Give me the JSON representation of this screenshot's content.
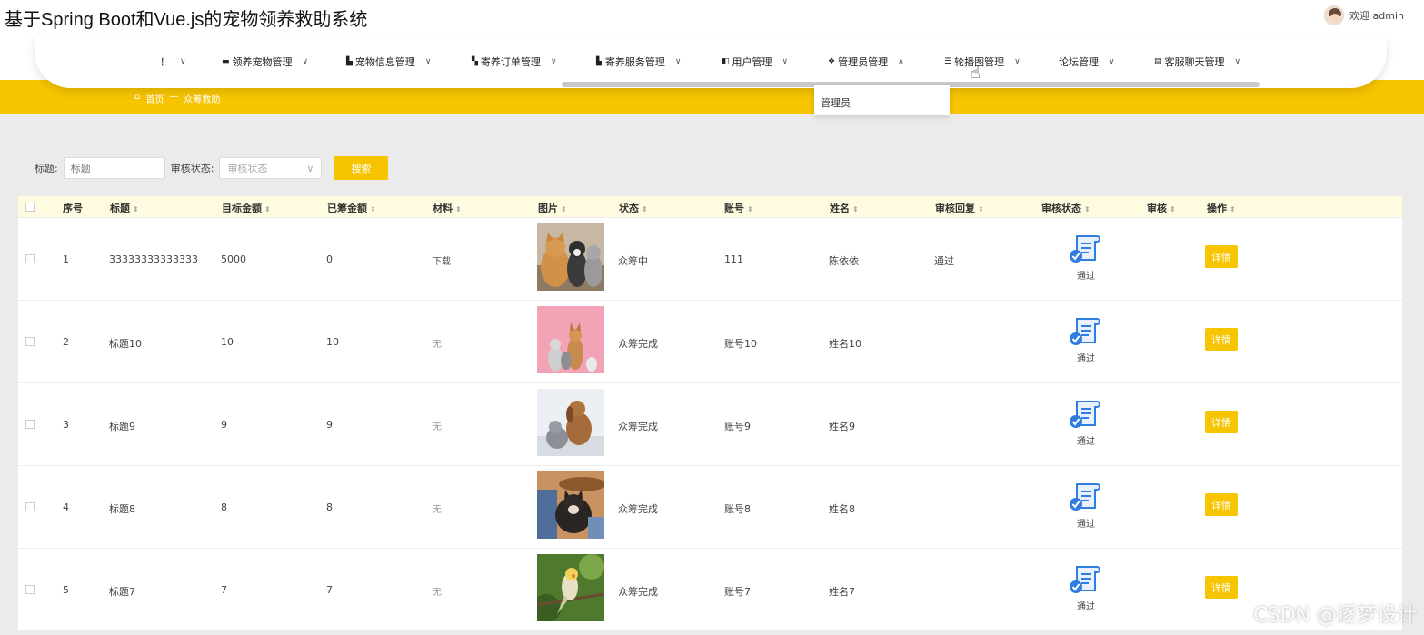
{
  "app": {
    "title": "基于Spring Boot和Vue.js的宠物领养救助系统"
  },
  "user": {
    "greeting": "欢迎 admin"
  },
  "nav": [
    {
      "label": "！",
      "icon": ""
    },
    {
      "label": "领养宠物管理",
      "icon": "folder-icon"
    },
    {
      "label": "宠物信息管理",
      "icon": "chart-icon"
    },
    {
      "label": "寄养订单管理",
      "icon": "grid-icon"
    },
    {
      "label": "寄养服务管理",
      "icon": "chart-icon"
    },
    {
      "label": "用户管理",
      "icon": "card-icon"
    },
    {
      "label": "管理员管理",
      "icon": "apps-icon"
    },
    {
      "label": "轮播图管理",
      "icon": "list-icon"
    },
    {
      "label": "论坛管理",
      "icon": ""
    },
    {
      "label": "客服聊天管理",
      "icon": "chat-icon"
    }
  ],
  "dropdown": {
    "item": "管理员"
  },
  "breadcrumb": {
    "home": "首页",
    "sep": "—",
    "current": "众筹救助"
  },
  "search": {
    "title_label": "标题:",
    "title_placeholder": "标题",
    "status_label": "审核状态:",
    "status_placeholder": "审核状态",
    "button": "搜索"
  },
  "table": {
    "headers": [
      "序号",
      "标题",
      "目标金额",
      "已筹金额",
      "材料",
      "图片",
      "状态",
      "账号",
      "姓名",
      "审核回复",
      "审核状态",
      "审核",
      "操作"
    ],
    "rows": [
      {
        "no": "1",
        "title": "33333333333333",
        "target": "5000",
        "raised": "0",
        "material": "下载",
        "status": "众筹中",
        "account": "111",
        "name": "陈依依",
        "reply": "通过",
        "audit": "通过",
        "action": "详情"
      },
      {
        "no": "2",
        "title": "标题10",
        "target": "10",
        "raised": "10",
        "material": "无",
        "status": "众筹完成",
        "account": "账号10",
        "name": "姓名10",
        "reply": "",
        "audit": "通过",
        "action": "详情"
      },
      {
        "no": "3",
        "title": "标题9",
        "target": "9",
        "raised": "9",
        "material": "无",
        "status": "众筹完成",
        "account": "账号9",
        "name": "姓名9",
        "reply": "",
        "audit": "通过",
        "action": "详情"
      },
      {
        "no": "4",
        "title": "标题8",
        "target": "8",
        "raised": "8",
        "material": "无",
        "status": "众筹完成",
        "account": "账号8",
        "name": "姓名8",
        "reply": "",
        "audit": "通过",
        "action": "详情"
      },
      {
        "no": "5",
        "title": "标题7",
        "target": "7",
        "raised": "7",
        "material": "无",
        "status": "众筹完成",
        "account": "账号7",
        "name": "姓名7",
        "reply": "",
        "audit": "通过",
        "action": "详情"
      }
    ]
  },
  "watermark": "CSDN @逐梦设计",
  "colors": {
    "accent": "#f7c400",
    "header_row": "#fffbe0",
    "audit_icon": "#2f7de1"
  }
}
